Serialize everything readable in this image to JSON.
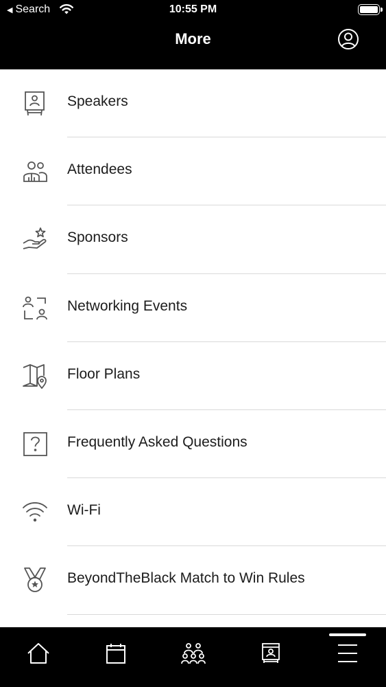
{
  "status_bar": {
    "back_label": "Search",
    "time": "10:55 PM"
  },
  "header": {
    "title": "More"
  },
  "menu": {
    "items": [
      {
        "label": "Speakers",
        "icon": "speaker-podium-icon"
      },
      {
        "label": "Attendees",
        "icon": "people-icon"
      },
      {
        "label": "Sponsors",
        "icon": "hand-star-icon"
      },
      {
        "label": "Networking Events",
        "icon": "networking-icon"
      },
      {
        "label": "Floor Plans",
        "icon": "map-pin-icon"
      },
      {
        "label": "Frequently Asked Questions",
        "icon": "question-box-icon"
      },
      {
        "label": "Wi-Fi",
        "icon": "wifi-icon"
      },
      {
        "label": "BeyondTheBlack Match to Win Rules",
        "icon": "medal-icon"
      }
    ]
  },
  "tabbar": {
    "tabs": [
      {
        "name": "home",
        "icon": "home-icon"
      },
      {
        "name": "schedule",
        "icon": "calendar-icon"
      },
      {
        "name": "people",
        "icon": "group-icon"
      },
      {
        "name": "exhibitors",
        "icon": "booth-icon"
      },
      {
        "name": "more",
        "icon": "menu-icon",
        "selected": true
      }
    ]
  },
  "colors": {
    "header_bg": "#000000",
    "text": "#1c1c1c",
    "icon": "#555555",
    "divider": "#d9d9d9"
  }
}
